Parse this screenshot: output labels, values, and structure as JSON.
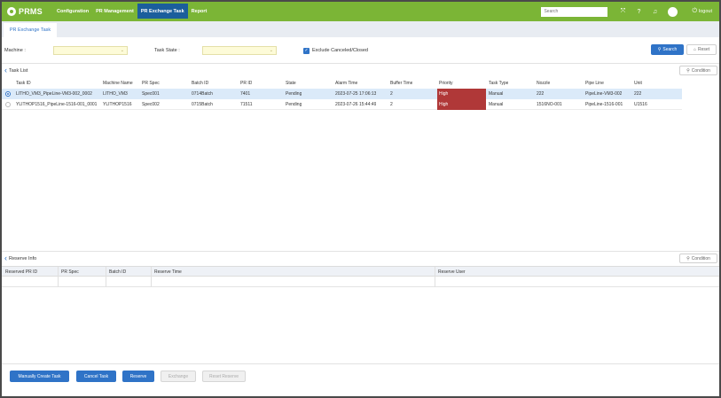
{
  "app": {
    "name": "PRMS"
  },
  "nav": {
    "items": [
      {
        "label": "Configuration"
      },
      {
        "label": "PR Management"
      },
      {
        "label": "PR Exchange Task"
      },
      {
        "label": "Report"
      }
    ],
    "active_index": 2
  },
  "topbar": {
    "search_placeholder": "Search",
    "logout_label": "logout",
    "icons": [
      "fullscreen-icon",
      "help-icon",
      "bell-icon",
      "avatar",
      "power-icon"
    ]
  },
  "tab": {
    "label": "PR Exchange Task"
  },
  "filter": {
    "machine_label": "Machine :",
    "task_state_label": "Task State :",
    "exclude_label": "Exclude Canceled/Closed",
    "exclude_checked": true,
    "search_label": "Search",
    "reset_label": "Reset"
  },
  "task_list": {
    "title": "Task List",
    "condition_label": "Condition",
    "columns": [
      "Task ID",
      "Machine Name",
      "PR Spec",
      "Batch ID",
      "PR ID",
      "State",
      "Alarm Time",
      "Buffer Time",
      "Priority",
      "Task Type",
      "Nozzle",
      "Pipe Line",
      "Unit"
    ],
    "rows": [
      {
        "selected": true,
        "cells": [
          "LITHO_VM3_PipeLine-VM3-002_0002",
          "LITHO_VM3",
          "Spec001",
          "0714Batch",
          "7401",
          "Pending",
          "2023-07-25 17:06:13",
          "2",
          "High",
          "Manual",
          "222",
          "PipeLine-VM3-002",
          "222"
        ]
      },
      {
        "selected": false,
        "cells": [
          "YLITHOP1516_PipeLine-1516-001_0001",
          "YLITHOP1516",
          "Spec002",
          "0715Batch",
          "71511",
          "Pending",
          "2023-07-26 15:44:49",
          "2",
          "High",
          "Manual",
          "1516NO-001",
          "PipeLine-1516-001",
          "U1516"
        ]
      }
    ]
  },
  "reserve_info": {
    "title": "Reserve Info",
    "condition_label": "Condition",
    "columns": [
      "Reserved PR ID",
      "PR Spec",
      "Batch ID",
      "Reserve Time",
      "Reserve User"
    ]
  },
  "actions": {
    "manually_create": "Manually Create Task",
    "cancel": "Cancel Task",
    "reserve": "Reserve",
    "exchange": "Exchange",
    "reset_reserve": "Reset Reserve"
  },
  "colors": {
    "topbar": "#7bb536",
    "nav_active": "#1b5e9c",
    "primary": "#2f73c7",
    "priority_high": "#b03838",
    "selected_row": "#dbeaf9"
  }
}
